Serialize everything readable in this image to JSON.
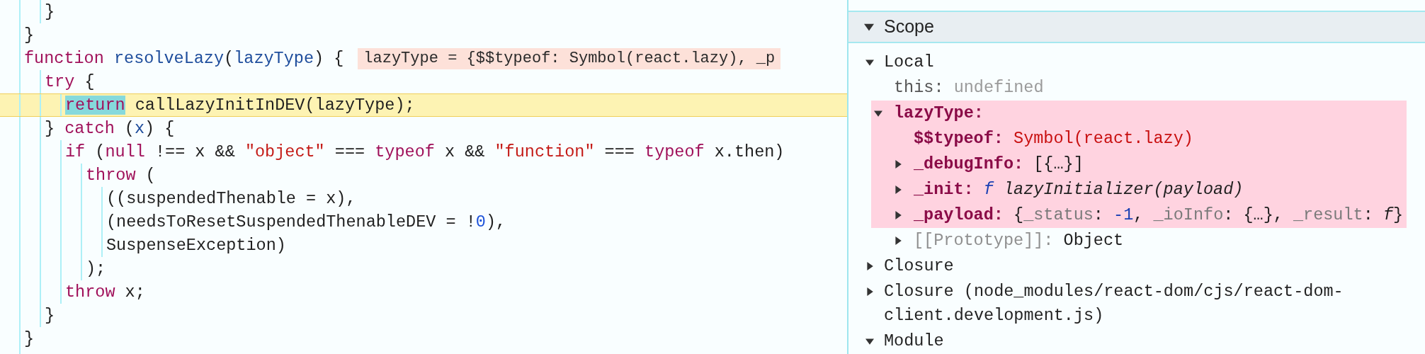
{
  "code": {
    "lines": [
      {
        "children": [
          {
            "tokens": [
              {
                "kind": "plain",
                "text": "}"
              }
            ],
            "paused": false
          }
        ]
      },
      {
        "tokens": [
          {
            "kind": "plain",
            "text": "}"
          }
        ],
        "paused": false
      },
      {
        "tokens": [
          {
            "kind": "kw",
            "text": "function "
          },
          {
            "kind": "def",
            "text": "resolveLazy"
          },
          {
            "kind": "plain",
            "text": "("
          },
          {
            "kind": "def",
            "text": "lazyType"
          },
          {
            "kind": "plain",
            "text": ") {"
          }
        ],
        "paused": false,
        "inline_value": "lazyType = {$$typeof: Symbol(react.lazy), _p",
        "children": [
          {
            "tokens": [
              {
                "kind": "kw",
                "text": "try"
              },
              {
                "kind": "plain",
                "text": " {"
              }
            ],
            "paused": false,
            "children": [
              {
                "tokens": [
                  {
                    "kind": "kw",
                    "text": "return"
                  },
                  {
                    "kind": "plain",
                    "text": " callLazyInitInDEV(lazyType);"
                  }
                ],
                "paused": true
              }
            ]
          },
          {
            "tokens": [
              {
                "kind": "plain",
                "text": "} "
              },
              {
                "kind": "kw",
                "text": "catch"
              },
              {
                "kind": "plain",
                "text": " ("
              },
              {
                "kind": "def",
                "text": "x"
              },
              {
                "kind": "plain",
                "text": ") {"
              }
            ],
            "paused": false,
            "children": [
              {
                "tokens": [
                  {
                    "kind": "kw",
                    "text": "if"
                  },
                  {
                    "kind": "plain",
                    "text": " ("
                  },
                  {
                    "kind": "kw",
                    "text": "null"
                  },
                  {
                    "kind": "plain",
                    "text": " !== x && "
                  },
                  {
                    "kind": "str",
                    "text": "\"object\""
                  },
                  {
                    "kind": "plain",
                    "text": " === "
                  },
                  {
                    "kind": "kw",
                    "text": "typeof"
                  },
                  {
                    "kind": "plain",
                    "text": " x && "
                  },
                  {
                    "kind": "str",
                    "text": "\"function\""
                  },
                  {
                    "kind": "plain",
                    "text": " === "
                  },
                  {
                    "kind": "kw",
                    "text": "typeof"
                  },
                  {
                    "kind": "plain",
                    "text": " x.then)"
                  }
                ],
                "paused": false,
                "children": [
                  {
                    "tokens": [
                      {
                        "kind": "kw",
                        "text": "throw"
                      },
                      {
                        "kind": "plain",
                        "text": " ("
                      }
                    ],
                    "paused": false,
                    "children": [
                      {
                        "tokens": [
                          {
                            "kind": "plain",
                            "text": "((suspendedThenable = x),"
                          }
                        ],
                        "paused": false
                      },
                      {
                        "tokens": [
                          {
                            "kind": "plain",
                            "text": "(needsToResetSuspendedThenableDEV = !"
                          },
                          {
                            "kind": "num",
                            "text": "0"
                          },
                          {
                            "kind": "plain",
                            "text": "),"
                          }
                        ],
                        "paused": false
                      },
                      {
                        "tokens": [
                          {
                            "kind": "plain",
                            "text": "SuspenseException)"
                          }
                        ],
                        "paused": false
                      }
                    ]
                  },
                  {
                    "tokens": [
                      {
                        "kind": "plain",
                        "text": ");"
                      }
                    ],
                    "paused": false
                  }
                ]
              },
              {
                "tokens": [
                  {
                    "kind": "kw",
                    "text": "throw"
                  },
                  {
                    "kind": "plain",
                    "text": " x;"
                  }
                ],
                "paused": false
              }
            ]
          },
          {
            "tokens": [
              {
                "kind": "plain",
                "text": "}"
              }
            ],
            "paused": false
          }
        ]
      },
      {
        "tokens": [
          {
            "kind": "plain",
            "text": "}"
          }
        ],
        "paused": false
      }
    ]
  },
  "scope": {
    "title": "Scope",
    "expanded": true,
    "sections": [
      {
        "label": "Local",
        "expanded": true,
        "properties": [
          {
            "name": "this:",
            "kind": "plain",
            "highlighted": false,
            "value": [
              {
                "kind": "dim",
                "text": "undefined"
              }
            ]
          },
          {
            "name": "lazyType:",
            "kind": "own",
            "expanded": true,
            "highlighted": true,
            "children": [
              {
                "name": "$$typeof:",
                "kind": "own",
                "highlighted": true,
                "value": [
                  {
                    "kind": "str",
                    "text": "Symbol(react.lazy)"
                  }
                ]
              },
              {
                "name": "_debugInfo:",
                "kind": "own",
                "expanded": false,
                "highlighted": true,
                "value": [
                  {
                    "kind": "plain",
                    "text": "[{…}]"
                  }
                ]
              },
              {
                "name": "_init:",
                "kind": "own",
                "expanded": false,
                "highlighted": true,
                "value": [
                  {
                    "kind": "fn",
                    "text": "f"
                  },
                  {
                    "kind": "italic",
                    "text": " lazyInitializer(payload)"
                  }
                ]
              },
              {
                "name": "_payload:",
                "kind": "own",
                "expanded": false,
                "highlighted": true,
                "value": [
                  {
                    "kind": "plain",
                    "text": "{"
                  },
                  {
                    "kind": "key",
                    "text": "_status"
                  },
                  {
                    "kind": "plain",
                    "text": ": "
                  },
                  {
                    "kind": "num",
                    "text": "-1"
                  },
                  {
                    "kind": "plain",
                    "text": ", "
                  },
                  {
                    "kind": "key",
                    "text": "_ioInfo"
                  },
                  {
                    "kind": "plain",
                    "text": ": {…}, "
                  },
                  {
                    "kind": "key",
                    "text": "_result"
                  },
                  {
                    "kind": "plain",
                    "text": ": "
                  },
                  {
                    "kind": "italic",
                    "text": "f"
                  },
                  {
                    "kind": "plain",
                    "text": "}"
                  }
                ]
              },
              {
                "name": "[[Prototype]]:",
                "kind": "internal",
                "expanded": false,
                "highlighted": false,
                "value": [
                  {
                    "kind": "plain",
                    "text": "Object"
                  }
                ]
              }
            ]
          }
        ]
      },
      {
        "label": "Closure",
        "expanded": false
      },
      {
        "label": "Closure (node_modules/react-dom/cjs/react-dom-client.development.js)",
        "expanded": false
      },
      {
        "label": "Module",
        "expanded": true
      }
    ]
  }
}
